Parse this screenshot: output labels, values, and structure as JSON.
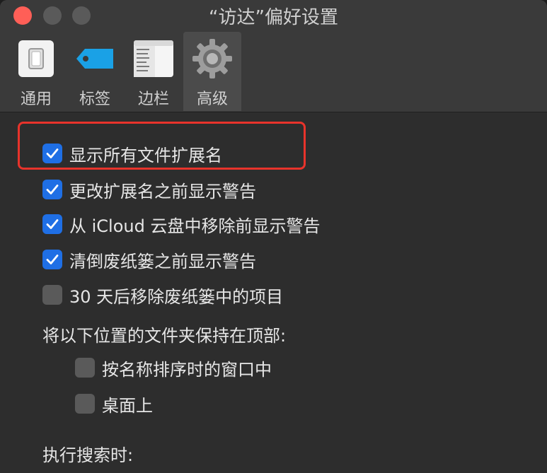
{
  "window": {
    "title": "“访达”偏好设置"
  },
  "toolbar": {
    "tabs": [
      {
        "label": "通用",
        "icon": "general-switch-icon"
      },
      {
        "label": "标签",
        "icon": "tag-icon"
      },
      {
        "label": "边栏",
        "icon": "sidebar-icon"
      },
      {
        "label": "高级",
        "icon": "gear-icon",
        "active": true
      }
    ]
  },
  "options": [
    {
      "label": "显示所有文件扩展名",
      "checked": true,
      "highlighted": true
    },
    {
      "label": "更改扩展名之前显示警告",
      "checked": true
    },
    {
      "label": "从 iCloud 云盘中移除前显示警告",
      "checked": true
    },
    {
      "label": "清倒废纸篓之前显示警告",
      "checked": true
    },
    {
      "label": "30 天后移除废纸篓中的项目",
      "checked": false
    }
  ],
  "folders_section": {
    "heading": "将以下位置的文件夹保持在顶部:",
    "options": [
      {
        "label": "按名称排序时的窗口中",
        "checked": false
      },
      {
        "label": "桌面上",
        "checked": false
      }
    ]
  },
  "search_section": {
    "heading": "执行搜索时:"
  },
  "colors": {
    "checkbox_checked": "#1f6fe5",
    "highlight_border": "#e8332b",
    "close_button": "#ff5f57"
  }
}
